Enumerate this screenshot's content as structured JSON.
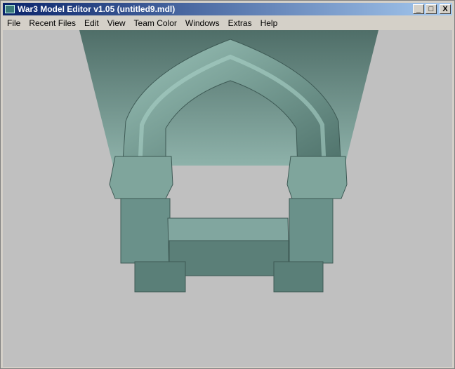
{
  "window": {
    "title": "War3 Model Editor v1.05 (untitled9.mdl)",
    "minimize": "_",
    "maximize": "□",
    "close": "X"
  },
  "menu": [
    "File",
    "Recent Files",
    "Edit",
    "View",
    "Team Color",
    "Windows",
    "Extras",
    "Help"
  ],
  "viewport": {
    "model_color": "#6f9990",
    "background": "#c0c0c0"
  }
}
